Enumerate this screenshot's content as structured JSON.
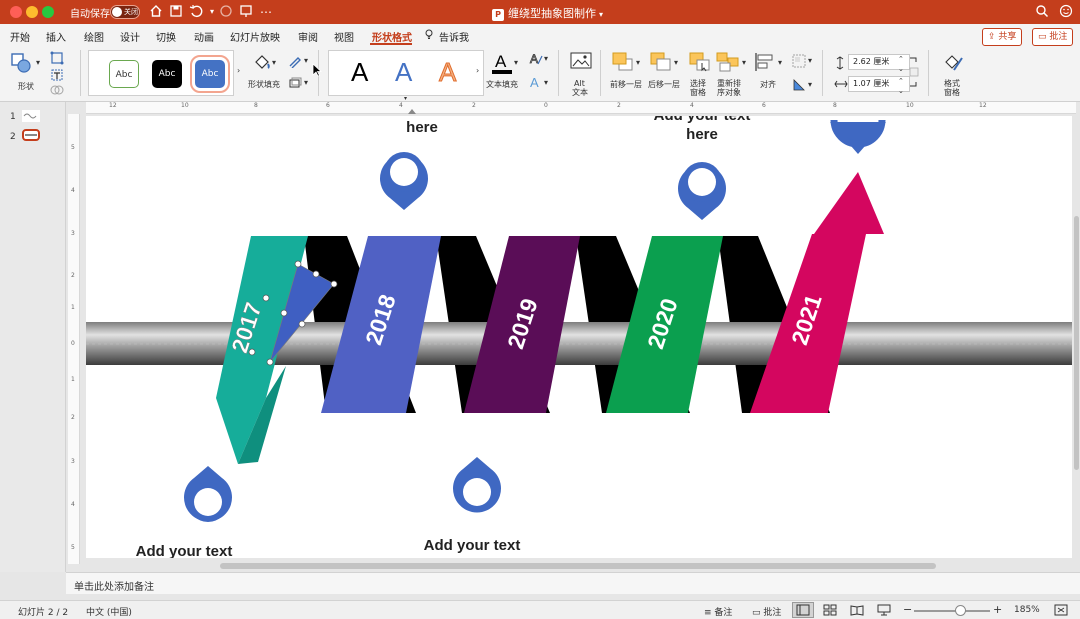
{
  "titlebar": {
    "autosave_label": "自动保存",
    "autosave_state": "关闭",
    "doc_title": "缠绕型抽象图制作"
  },
  "menu": {
    "items": [
      "开始",
      "插入",
      "绘图",
      "设计",
      "切换",
      "动画",
      "幻灯片放映",
      "审阅",
      "视图",
      "形状格式"
    ],
    "tell_me": "告诉我",
    "share": "共享",
    "comments": "批注"
  },
  "ribbon": {
    "shapes_label": "形状",
    "style_samples": [
      "Abc",
      "Abc",
      "Abc"
    ],
    "shape_fill_label": "形状填充",
    "wordart_letter": "A",
    "text_fill_label": "文本填充",
    "alt_text_label_1": "Alt",
    "alt_text_label_2": "文本",
    "bring_forward_label": "前移一层",
    "send_backward_label": "后移一层",
    "selection_pane_label_1": "选择",
    "selection_pane_label_2": "窗格",
    "reorder_label_1": "重新排",
    "reorder_label_2": "序对象",
    "align_label": "对齐",
    "height_value": "2.62 厘米",
    "width_value": "1.07 厘米",
    "format_pane_label_1": "格式",
    "format_pane_label_2": "窗格"
  },
  "thumbnails": [
    "1",
    "2"
  ],
  "ruler_top": [
    "12",
    "10",
    "8",
    "6",
    "4",
    "2",
    "0",
    "2",
    "4",
    "6",
    "8",
    "10",
    "12"
  ],
  "ruler_left": [
    "5",
    "4",
    "3",
    "2",
    "1",
    "0",
    "1",
    "2",
    "3",
    "4",
    "5"
  ],
  "slide": {
    "years": [
      "2017",
      "2018",
      "2019",
      "2020",
      "2021"
    ],
    "text_top_2018": "here",
    "text_top_2020_line1": "Add your text",
    "text_top_2020_line2": "here",
    "text_bottom_2017": "Add your text",
    "text_bottom_2019": "Add your text",
    "colors": {
      "teal": "#16ad9a",
      "blue": "#5061c4",
      "purple": "#5a0d57",
      "green": "#0b9f4f",
      "magenta": "#d4065f",
      "pin": "#3f68c2"
    }
  },
  "notes_placeholder": "单击此处添加备注",
  "status": {
    "slide_counter": "幻灯片 2 / 2",
    "language": "中文 (中国)",
    "notes": "备注",
    "comments": "批注",
    "zoom": "185%"
  }
}
